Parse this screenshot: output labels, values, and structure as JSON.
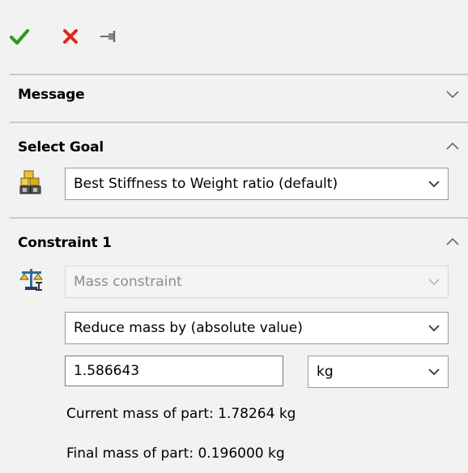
{
  "toolbar": {
    "ok_icon": "checkmark-icon",
    "cancel_icon": "close-icon",
    "pin_icon": "pushpin-icon",
    "ok_color": "#2e9b1f",
    "cancel_color": "#e0261a"
  },
  "sections": {
    "message": {
      "title": "Message",
      "collapsed": true
    },
    "goal": {
      "title": "Select Goal",
      "icon": "weights-icon",
      "goal_value": "Best Stiffness to Weight ratio (default)"
    },
    "constraint": {
      "title": "Constraint 1",
      "icon": "balance-scale-icon",
      "type_value": "Mass constraint",
      "mode_value": "Reduce mass by (absolute value)",
      "amount_value": "1.586643",
      "unit_value": "kg",
      "current_mass_text": "Current mass of part: 1.78264 kg",
      "final_mass_text": "Final mass of part: 0.196000 kg"
    }
  }
}
